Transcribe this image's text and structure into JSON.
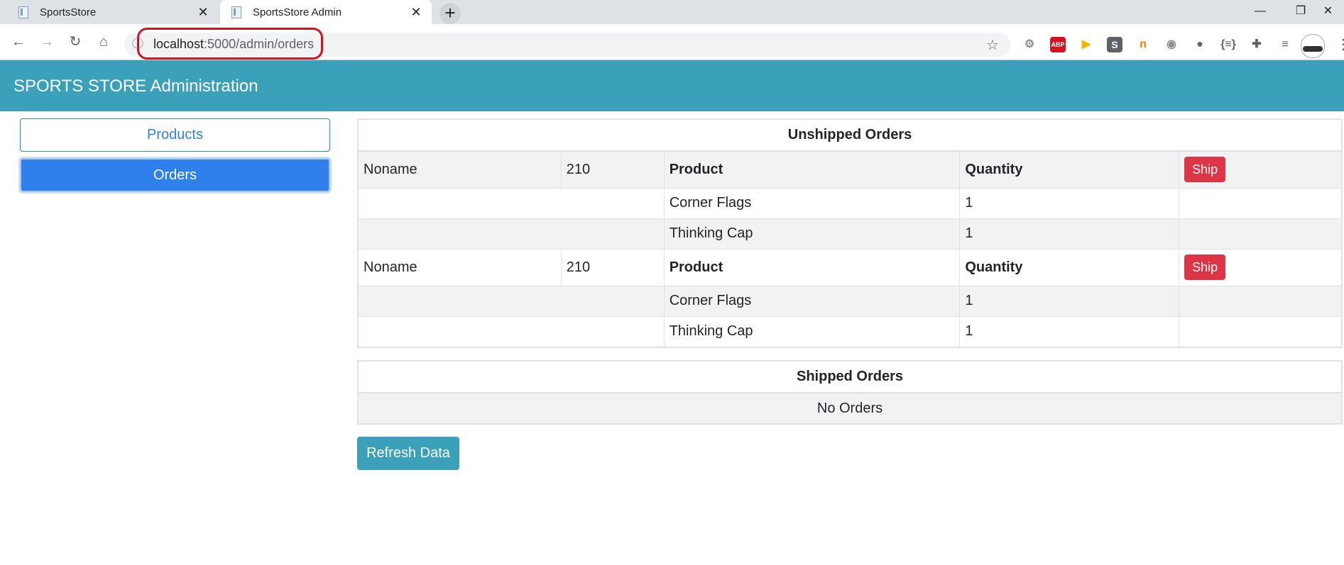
{
  "browser": {
    "tabs": [
      {
        "title": "SportsStore",
        "active": false
      },
      {
        "title": "SportsStore Admin",
        "active": true
      }
    ],
    "close_glyph": "✕",
    "new_tab_glyph": "+",
    "window_controls": {
      "minimize": "—",
      "restore": "❐",
      "close": "✕"
    },
    "nav": {
      "back": "←",
      "forward": "→",
      "reload": "↻",
      "home": "⌂"
    },
    "url_host": "localhost",
    "url_path": ":5000/admin/orders",
    "info_icon": "ⓘ",
    "star_glyph": "☆",
    "extensions": [
      {
        "icon": "gear-icon",
        "glyph": "⚙",
        "color": "#8e8e8e"
      },
      {
        "icon": "adblock-icon",
        "glyph": "ABP",
        "color": "#d3131f"
      },
      {
        "icon": "play-icon",
        "glyph": "▶",
        "color": "#f4b400"
      },
      {
        "icon": "s-icon",
        "glyph": "S",
        "color": "#5f6368"
      },
      {
        "icon": "n-icon",
        "glyph": "n",
        "color": "#f57c00"
      },
      {
        "icon": "signal-icon",
        "glyph": "◉",
        "color": "#8e8e8e"
      },
      {
        "icon": "circles-icon",
        "glyph": "●",
        "color": "#5f6368"
      },
      {
        "icon": "json-icon",
        "glyph": "{≡}",
        "color": "#5f6368"
      },
      {
        "icon": "puzzle-icon",
        "glyph": "✚",
        "color": "#5f6368"
      },
      {
        "icon": "playlist-icon",
        "glyph": "≡",
        "color": "#5f6368"
      }
    ]
  },
  "app": {
    "title": "SPORTS STORE Administration",
    "accent": "#3ba0b9",
    "primary": "#2f80ed",
    "danger": "#dc3545"
  },
  "sidebar": {
    "items": [
      {
        "label": "Products",
        "active": false
      },
      {
        "label": "Orders",
        "active": true
      }
    ]
  },
  "unshipped": {
    "title": "Unshipped Orders",
    "product_header": "Product",
    "quantity_header": "Quantity",
    "ship_label": "Ship",
    "orders": [
      {
        "name": "Noname",
        "zip": "210",
        "lines": [
          {
            "product": "Corner Flags",
            "quantity": "1"
          },
          {
            "product": "Thinking Cap",
            "quantity": "1"
          }
        ]
      },
      {
        "name": "Noname",
        "zip": "210",
        "lines": [
          {
            "product": "Corner Flags",
            "quantity": "1"
          },
          {
            "product": "Thinking Cap",
            "quantity": "1"
          }
        ]
      }
    ]
  },
  "shipped": {
    "title": "Shipped Orders",
    "empty_text": "No Orders"
  },
  "refresh_label": "Refresh Data"
}
